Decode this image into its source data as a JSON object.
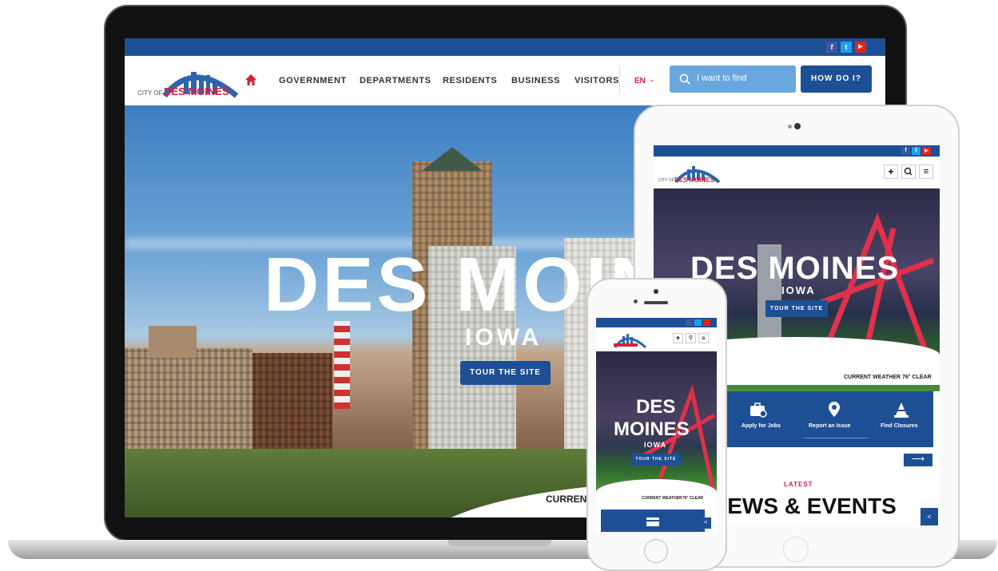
{
  "desktop": {
    "social": [
      "f",
      "t",
      "▶"
    ],
    "logo": {
      "prefix": "CITY OF",
      "name": "DES MOINES"
    },
    "nav": [
      "GOVERNMENT",
      "DEPARTMENTS",
      "RESIDENTS",
      "BUSINESS",
      "VISITORS"
    ],
    "lang": "EN",
    "search_placeholder": "I want to find",
    "howdoi": "HOW DO I?",
    "hero": {
      "title": "DES MOINES",
      "subtitle": "IOWA",
      "button": "TOUR THE SITE",
      "weather": "CURRENT"
    },
    "colors": {
      "brand": "#1d4f95",
      "accent": "#d81f3a",
      "search": "#6aa7de"
    }
  },
  "tablet": {
    "social": [
      "f",
      "t",
      "▶"
    ],
    "logo": {
      "prefix": "CITY OF",
      "name": "DES MOINES"
    },
    "hero": {
      "title": "DES MOINES",
      "subtitle": "IOWA",
      "button": "TOUR THE SITE"
    },
    "weather": {
      "label": "CURRENT WEATHER",
      "value": "76° CLEAR"
    },
    "tiles": [
      "Apply for Jobs",
      "Report an Issue",
      "Find Closures"
    ],
    "latest": "LATEST",
    "news": "NEWS & EVENTS"
  },
  "phone": {
    "hero": {
      "title_line1": "DES",
      "title_line2": "MOINES",
      "subtitle": "IOWA",
      "button": "TOUR THE SITE"
    },
    "weather": {
      "label": "CURRENT WEATHER",
      "value": "76° CLEAR"
    }
  }
}
